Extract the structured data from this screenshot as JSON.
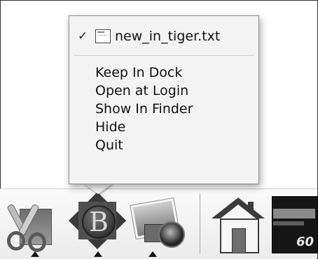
{
  "menu": {
    "checkmark": "✓",
    "file_name": "new_in_tiger.txt",
    "items": [
      {
        "label": "Keep In Dock"
      },
      {
        "label": "Open at Login"
      },
      {
        "label": "Show In Finder"
      },
      {
        "label": "Hide"
      },
      {
        "label": "Quit"
      }
    ]
  },
  "dock": {
    "apps": [
      {
        "icon": "scissors-app-icon",
        "running": true
      },
      {
        "icon": "b-app-icon",
        "running": true
      },
      {
        "icon": "iphoto-icon",
        "running": true
      },
      {
        "icon": "home-folder-icon",
        "running": false
      },
      {
        "icon": "book-thumbnail-icon",
        "running": false
      }
    ],
    "book_badge": "60"
  }
}
